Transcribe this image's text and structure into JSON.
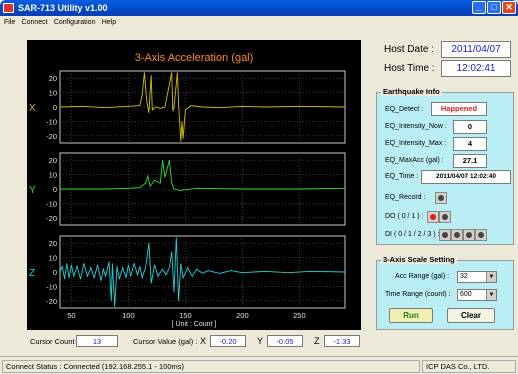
{
  "window": {
    "title": "SAR-713 Utility v1.00"
  },
  "menu": [
    "File",
    "Connect",
    "Configuration",
    "Help"
  ],
  "chart_data": {
    "type": "line",
    "title": "3-Axis Acceleration (gal)",
    "xlabel": "[ Unit : Count ]",
    "x_ticks": [
      50,
      100,
      150,
      200,
      250
    ],
    "xlim": [
      40,
      290
    ],
    "y_ticks": [
      20,
      10,
      0,
      -10,
      -20
    ],
    "ylim": [
      -25,
      25
    ],
    "series": [
      {
        "name": "X",
        "color": "#d4c000",
        "points": [
          [
            40,
            0
          ],
          [
            60,
            0.5
          ],
          [
            80,
            -0.5
          ],
          [
            100,
            0.5
          ],
          [
            110,
            1
          ],
          [
            112,
            8
          ],
          [
            114,
            24
          ],
          [
            116,
            5
          ],
          [
            118,
            -4
          ],
          [
            120,
            22
          ],
          [
            121,
            -2
          ],
          [
            124,
            0
          ],
          [
            128,
            -1
          ],
          [
            132,
            0
          ],
          [
            138,
            24
          ],
          [
            139,
            -3
          ],
          [
            140,
            0
          ],
          [
            143,
            24
          ],
          [
            144,
            2
          ],
          [
            146,
            -24
          ],
          [
            147,
            -10
          ],
          [
            148,
            -22
          ],
          [
            150,
            -2
          ],
          [
            155,
            1
          ],
          [
            165,
            0
          ],
          [
            180,
            -0.5
          ],
          [
            200,
            0.5
          ],
          [
            220,
            0
          ],
          [
            250,
            0.5
          ],
          [
            290,
            0
          ]
        ]
      },
      {
        "name": "Y",
        "color": "#2ee22e",
        "points": [
          [
            40,
            0
          ],
          [
            80,
            0
          ],
          [
            100,
            0.5
          ],
          [
            110,
            1
          ],
          [
            115,
            4
          ],
          [
            117,
            9
          ],
          [
            119,
            2
          ],
          [
            123,
            6
          ],
          [
            128,
            4
          ],
          [
            130,
            20
          ],
          [
            132,
            8
          ],
          [
            136,
            20
          ],
          [
            138,
            4
          ],
          [
            140,
            0
          ],
          [
            145,
            -1
          ],
          [
            160,
            0.5
          ],
          [
            200,
            0
          ],
          [
            250,
            0
          ],
          [
            290,
            0.5
          ]
        ]
      },
      {
        "name": "Z",
        "color": "#20d0d8",
        "points": [
          [
            40,
            0
          ],
          [
            42,
            4
          ],
          [
            44,
            -5
          ],
          [
            46,
            6
          ],
          [
            48,
            -4
          ],
          [
            50,
            5
          ],
          [
            52,
            -3
          ],
          [
            55,
            4
          ],
          [
            58,
            -5
          ],
          [
            61,
            6
          ],
          [
            64,
            -3
          ],
          [
            67,
            3
          ],
          [
            70,
            -4
          ],
          [
            73,
            5
          ],
          [
            76,
            -6
          ],
          [
            78,
            2
          ],
          [
            80,
            -3
          ],
          [
            83,
            7
          ],
          [
            85,
            -20
          ],
          [
            86,
            6
          ],
          [
            88,
            -24
          ],
          [
            90,
            4
          ],
          [
            92,
            -5
          ],
          [
            95,
            3
          ],
          [
            98,
            -4
          ],
          [
            100,
            5
          ],
          [
            102,
            -3
          ],
          [
            105,
            6
          ],
          [
            108,
            -2
          ],
          [
            110,
            4
          ],
          [
            112,
            -4
          ],
          [
            115,
            3
          ],
          [
            118,
            20
          ],
          [
            120,
            -8
          ],
          [
            123,
            5
          ],
          [
            126,
            -3
          ],
          [
            130,
            2
          ],
          [
            133,
            -2
          ],
          [
            136,
            3
          ],
          [
            138,
            14
          ],
          [
            140,
            -14
          ],
          [
            142,
            24
          ],
          [
            144,
            -20
          ],
          [
            146,
            6
          ],
          [
            148,
            -4
          ],
          [
            152,
            3
          ],
          [
            156,
            -3
          ],
          [
            160,
            2
          ],
          [
            165,
            -1
          ],
          [
            170,
            1
          ],
          [
            180,
            -1
          ],
          [
            190,
            1
          ],
          [
            200,
            -0.5
          ],
          [
            220,
            0.5
          ],
          [
            240,
            -0.5
          ],
          [
            260,
            0.5
          ],
          [
            290,
            0
          ]
        ]
      }
    ]
  },
  "host": {
    "date_label": "Host Date :",
    "date": "2011/04/07",
    "time_label": "Host Time :",
    "time": "12:02:41"
  },
  "earthquake": {
    "title": "Earthquake Info",
    "detect_label": "EQ_Detect :",
    "detect": "Happened",
    "intensity_now_label": "EQ_Intensity_Now :",
    "intensity_now": "0",
    "intensity_max_label": "EQ_Intensity_Max :",
    "intensity_max": "4",
    "maxacc_label": "EQ_MaxAcc (gal) :",
    "maxacc": "27.1",
    "time_label": "EQ_Time :",
    "time": "2011/04/07 12:02:40",
    "record_label": "EQ_Record :",
    "do_label": "DO ( 0 / 1 ) :",
    "di_label": "DI ( 0 / 1 / 2 / 3 ) :"
  },
  "scale": {
    "title": "3-Axis Scale Setting",
    "acc_label": "Acc Range (gal) :",
    "acc_value": "32",
    "time_label": "Time Range (count) :",
    "time_value": "600",
    "run_label": "Run",
    "clear_label": "Clear"
  },
  "bottom": {
    "cursor_count_label": "Cursor Count :",
    "cursor_count": "13",
    "cursor_value_label": "Cursor Value (gal) :",
    "x_label": "X",
    "x_value": "-0.20",
    "y_label": "Y",
    "y_value": "-0.05",
    "z_label": "Z",
    "z_value": "-1.33"
  },
  "status": {
    "connect": "Connect Status : Connected (192.168.255.1 - 100ms)",
    "company": "ICP DAS Co., LTD."
  },
  "colors": {
    "accent": "#1a1adc",
    "panel": "#b8eef4",
    "run_button": "#f0f0b0"
  }
}
